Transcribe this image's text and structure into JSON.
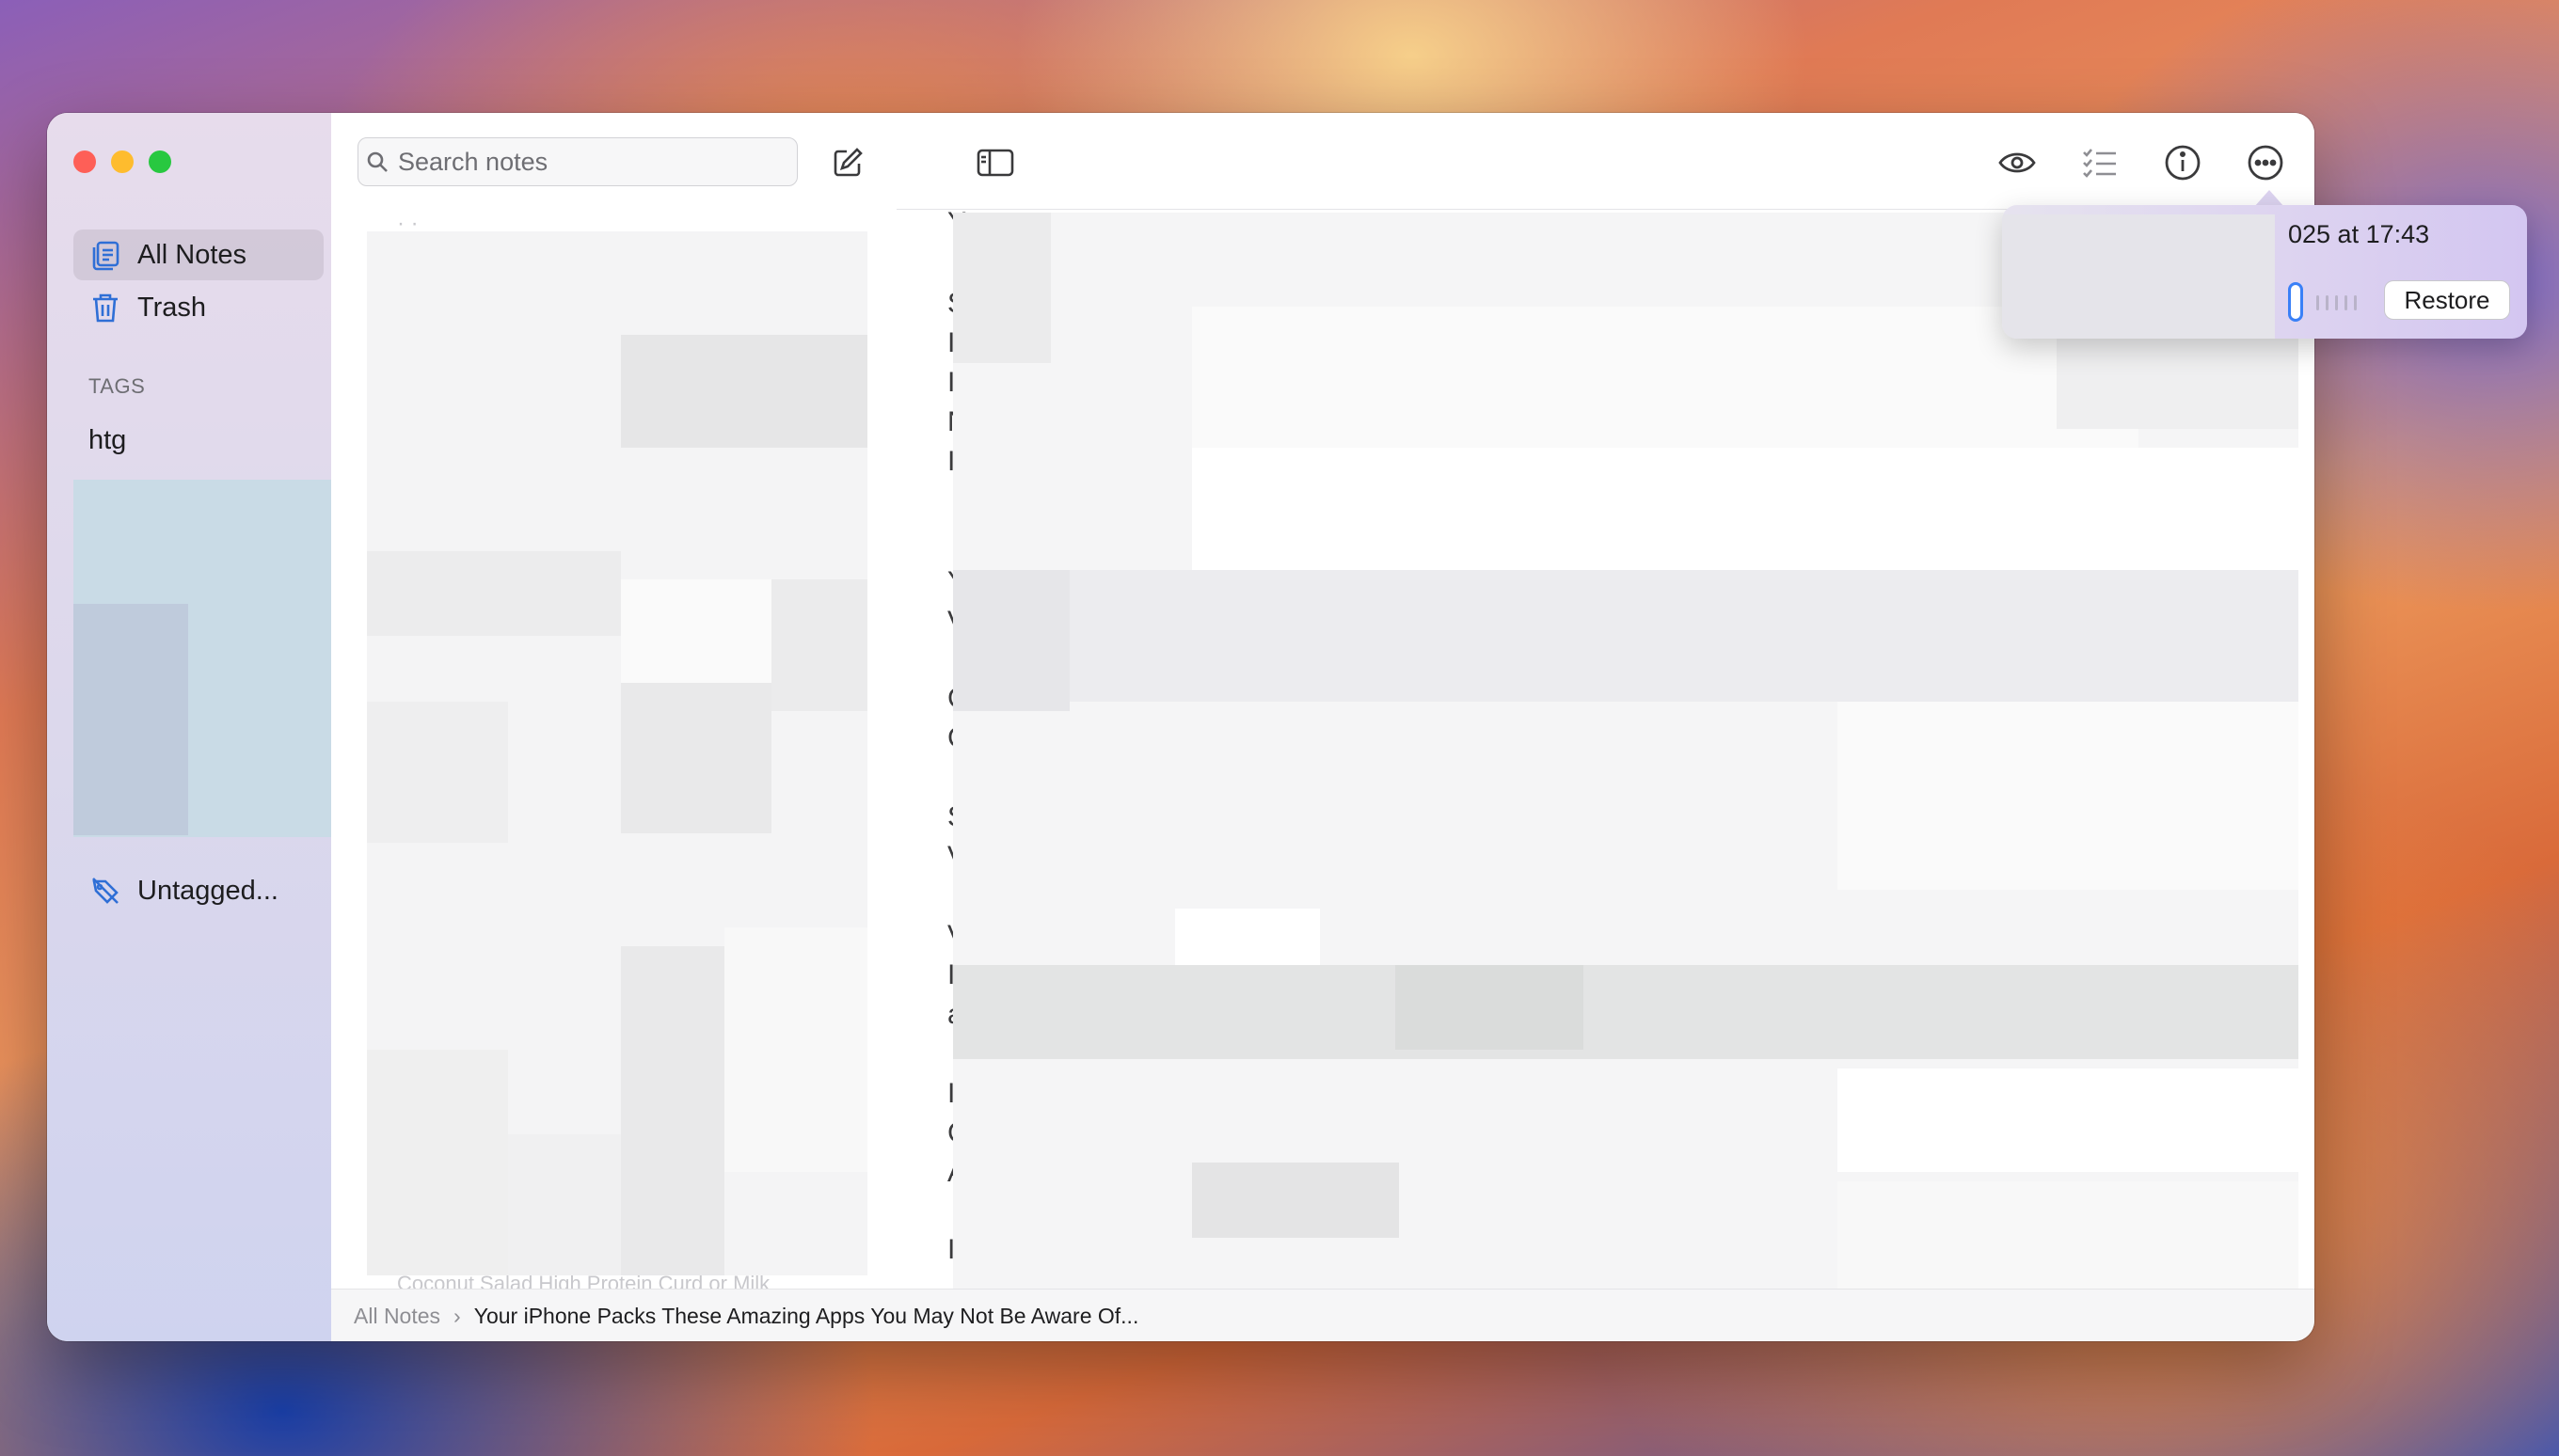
{
  "sidebar": {
    "items": [
      {
        "label": "All Notes",
        "icon": "notes-stack-icon"
      },
      {
        "label": "Trash",
        "icon": "trash-icon"
      }
    ],
    "tags_header": "TAGS",
    "tags": [
      "htg"
    ],
    "untagged_label": "Untagged..."
  },
  "list": {
    "search_placeholder": "Search notes",
    "faded_bottom_text": "Coconut Salad High Protein Curd or Milk"
  },
  "toolbar": {
    "icons": [
      "sidebar-toggle-icon",
      "preview-eye-icon",
      "checklist-icon",
      "info-icon",
      "more-options-icon"
    ]
  },
  "popover": {
    "date_text": "025 at 17:43",
    "restore_label": "Restore"
  },
  "statusbar": {
    "root": "All Notes",
    "title": "Your iPhone Packs These Amazing Apps You May Not Be Aware Of..."
  },
  "editor": {
    "visible_letters": [
      "Y",
      "S",
      "I",
      "I",
      "N",
      "I",
      "Y",
      "V",
      "C",
      "C",
      "S",
      "V",
      "V",
      "I",
      "a",
      "I",
      "C",
      "A",
      "I"
    ]
  },
  "colors": {
    "accent": "#3a80f7",
    "close": "#fe5f57",
    "minimize": "#febc2e",
    "maximize": "#28c840",
    "sidebar_icon": "#2f6fd6"
  }
}
